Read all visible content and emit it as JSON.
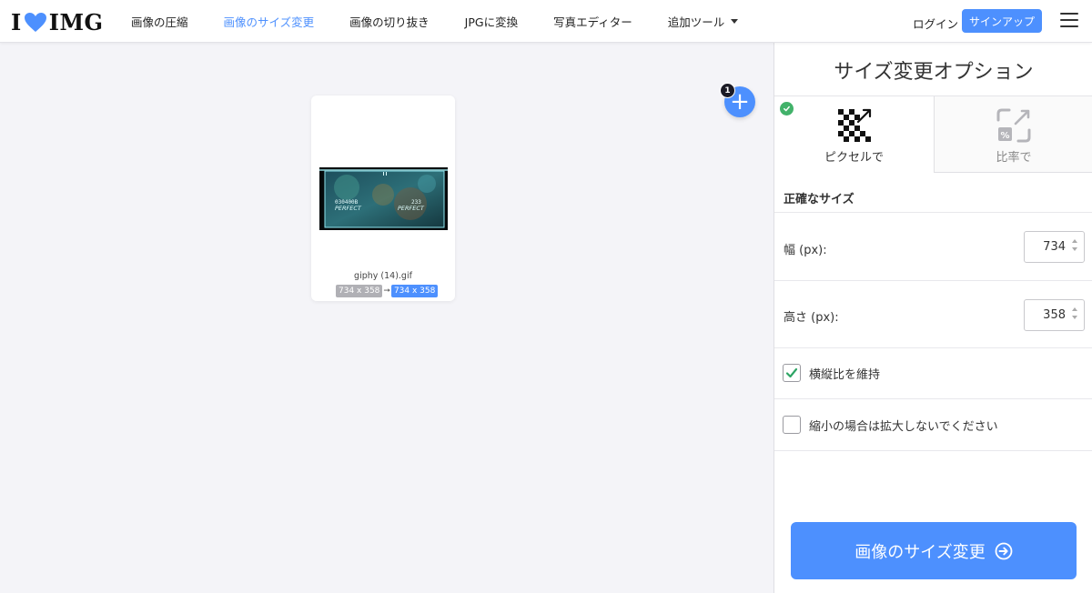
{
  "header": {
    "logo": {
      "left": "I",
      "right": "IMG",
      "heart_color": "#4d90fe"
    },
    "nav": [
      {
        "label": "画像の圧縮",
        "active": false
      },
      {
        "label": "画像のサイズ変更",
        "active": true
      },
      {
        "label": "画像の切り抜き",
        "active": false
      },
      {
        "label": "JPGに変換",
        "active": false
      },
      {
        "label": "写真エディター",
        "active": false
      },
      {
        "label": "追加ツール",
        "active": false,
        "dropdown": true
      }
    ],
    "login_label": "ログイン",
    "signup_label": "サインアップ",
    "menu_icon": "hamburger-icon"
  },
  "workspace": {
    "file": {
      "name": "giphy (14).gif",
      "original_size": "734 x 358",
      "new_size": "734 x 358",
      "thumb_text": {
        "left_score": "030400B",
        "left_grade": "PERFECT",
        "right_score": "233",
        "right_grade": "PERFECT"
      }
    },
    "add_button": {
      "icon": "plus-icon",
      "label": "+"
    },
    "file_count": "1"
  },
  "sidebar": {
    "title": "サイズ変更オプション",
    "modes": [
      {
        "label": "ピクセルで",
        "icon": "pixel-resize-icon",
        "selected": true
      },
      {
        "label": "比率で",
        "icon": "percent-resize-icon",
        "selected": false
      }
    ],
    "section_title": "正確なサイズ",
    "width": {
      "label": "幅 (px):",
      "value": "734"
    },
    "height": {
      "label": "高さ (px):",
      "value": "358"
    },
    "keep_ratio": {
      "label": "横縦比を維持",
      "checked": true
    },
    "no_enlarge": {
      "label": "縮小の場合は拡大しないでください",
      "checked": false
    },
    "submit_label": "画像のサイズ変更",
    "submit_icon": "arrow-circle-right-icon"
  },
  "colors": {
    "accent": "#4d90fe",
    "check_green": "#42b26a",
    "checkbox_tick": "#2ea565",
    "badge_dark": "#1b1b26"
  }
}
